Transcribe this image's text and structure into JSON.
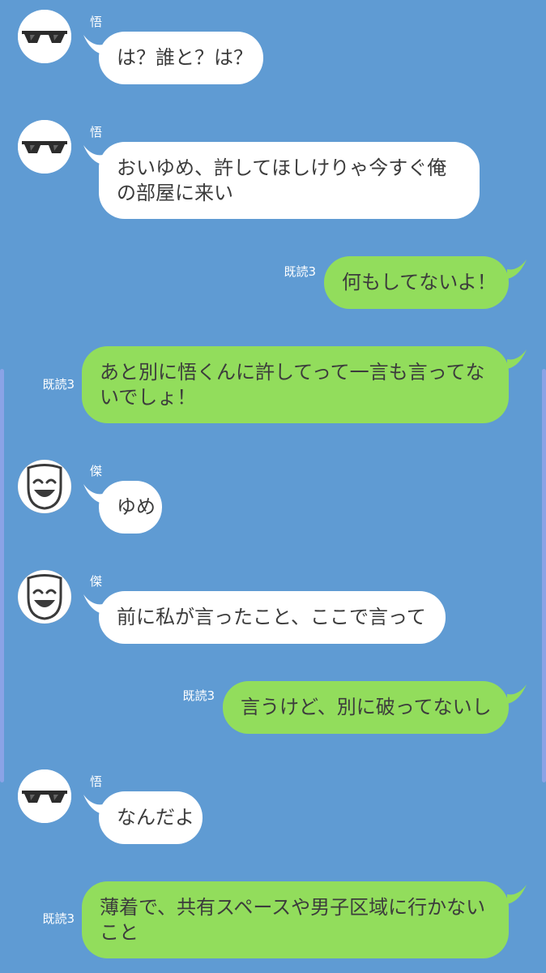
{
  "colors": {
    "background": "#5f9bd3",
    "incoming_bubble": "#ffffff",
    "outgoing_bubble": "#92dd5c",
    "text": "#3c3c3c"
  },
  "messages": [
    {
      "sender": "悟",
      "text": "は？誰と？は？"
    },
    {
      "sender": "悟",
      "text": "おいゆめ、許してほしけりゃ今すぐ俺の部屋に来い"
    },
    {
      "read": "既読3",
      "text": "何もしてないよ！"
    },
    {
      "read": "既読3",
      "text": "あと別に悟くんに許してって一言も言ってないでしょ！"
    },
    {
      "sender": "傑",
      "text": "ゆめ"
    },
    {
      "sender": "傑",
      "text": "前に私が言ったこと、ここで言って"
    },
    {
      "read": "既読3",
      "text": "言うけど、別に破ってないし"
    },
    {
      "sender": "悟",
      "text": "なんだよ"
    },
    {
      "read": "既読3",
      "text": "薄着で、共有スペースや男子区域に行かないこと"
    }
  ],
  "icons": {
    "gojo_avatar": "sunglasses-icon",
    "geto_avatar": "smiling-mask-icon"
  }
}
